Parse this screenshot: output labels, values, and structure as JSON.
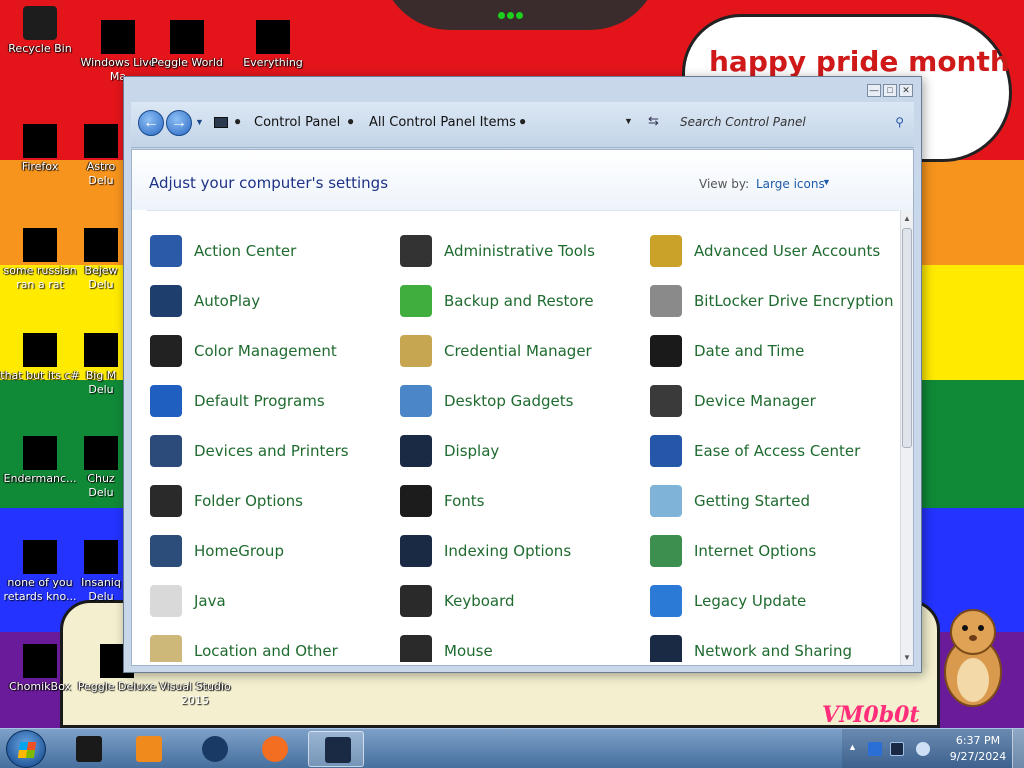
{
  "wallpaper": {
    "speech_text": "happy pride month",
    "watermark": "VM0b0t",
    "colors": {
      "red": "#e3151b",
      "orange": "#f7941d",
      "yellow": "#ffea00",
      "green": "#108a37",
      "blue": "#2433ff",
      "purple": "#6a1b9a"
    }
  },
  "desktop": {
    "icons": [
      {
        "label": "Recycle Bin",
        "icon": "recycle-bin-icon"
      },
      {
        "label": "Windows Live",
        "label2": "Ma",
        "icon": "windows-live-icon"
      },
      {
        "label": "Peggle World",
        "icon": "peggle-world-icon"
      },
      {
        "label": "Everything",
        "icon": "everything-icon"
      },
      {
        "label": "Firefox",
        "icon": "firefox-icon"
      },
      {
        "label": "Astro",
        "label2": "Delu",
        "icon": "astro-icon"
      },
      {
        "label": "some russian",
        "label2": "ran a rat",
        "icon": "file-icon"
      },
      {
        "label": "Bejew",
        "label2": "Delu",
        "icon": "bejeweled-icon"
      },
      {
        "label": "that but its c#",
        "icon": "shortcut-icon"
      },
      {
        "label": "Big M",
        "label2": "Delu",
        "icon": "big-money-icon"
      },
      {
        "label": "Endermanc...",
        "icon": "endermanch-icon"
      },
      {
        "label": "Chuz",
        "label2": "Delu",
        "icon": "chuzzle-icon"
      },
      {
        "label": "none of you",
        "label2": "retards kno...",
        "icon": "chrome-icon"
      },
      {
        "label": "Insaniq",
        "label2": "Delu",
        "icon": "insaniquarium-icon"
      },
      {
        "label": "ChomikBox",
        "icon": "chomikbox-icon"
      },
      {
        "label": "Peggle Deluxe",
        "icon": "peggle-deluxe-icon"
      },
      {
        "label": "Visual Studio",
        "label2": "2015",
        "icon": "visual-studio-icon"
      }
    ]
  },
  "window": {
    "breadcrumb": [
      "Control Panel",
      "All Control Panel Items"
    ],
    "search_placeholder": "Search Control Panel",
    "title": "Adjust your computer's settings",
    "view_by_label": "View by:",
    "view_by_value": "Large icons",
    "items": [
      {
        "name": "Action Center",
        "icon": "action-center-icon",
        "color": "#2a5aa8"
      },
      {
        "name": "Administrative Tools",
        "icon": "administrative-tools-icon",
        "color": "#333333"
      },
      {
        "name": "Advanced User Accounts",
        "icon": "user-accounts-icon",
        "color": "#c9a227"
      },
      {
        "name": "AutoPlay",
        "icon": "autoplay-icon",
        "color": "#1e3f6e"
      },
      {
        "name": "Backup and Restore",
        "icon": "backup-restore-icon",
        "color": "#3fae3f"
      },
      {
        "name": "BitLocker Drive Encryption",
        "icon": "bitlocker-icon",
        "color": "#8a8a8a"
      },
      {
        "name": "Color Management",
        "icon": "color-management-icon",
        "color": "#222222"
      },
      {
        "name": "Credential Manager",
        "icon": "credential-manager-icon",
        "color": "#c6a650"
      },
      {
        "name": "Date and Time",
        "icon": "date-time-icon",
        "color": "#1a1a1a"
      },
      {
        "name": "Default Programs",
        "icon": "default-programs-icon",
        "color": "#1f5fbf"
      },
      {
        "name": "Desktop Gadgets",
        "icon": "desktop-gadgets-icon",
        "color": "#4a86c8"
      },
      {
        "name": "Device Manager",
        "icon": "device-manager-icon",
        "color": "#3a3a3a"
      },
      {
        "name": "Devices and Printers",
        "icon": "devices-printers-icon",
        "color": "#2c4a7a"
      },
      {
        "name": "Display",
        "icon": "display-icon",
        "color": "#1b2a44"
      },
      {
        "name": "Ease of Access Center",
        "icon": "ease-of-access-icon",
        "color": "#2457a8"
      },
      {
        "name": "Folder Options",
        "icon": "folder-options-icon",
        "color": "#2a2a2a"
      },
      {
        "name": "Fonts",
        "icon": "fonts-icon",
        "color": "#1c1c1c"
      },
      {
        "name": "Getting Started",
        "icon": "getting-started-icon",
        "color": "#7fb4d8"
      },
      {
        "name": "HomeGroup",
        "icon": "homegroup-icon",
        "color": "#2c4d7a"
      },
      {
        "name": "Indexing Options",
        "icon": "indexing-options-icon",
        "color": "#1b2a44"
      },
      {
        "name": "Internet Options",
        "icon": "internet-options-icon",
        "color": "#3c8f4f"
      },
      {
        "name": "Java",
        "icon": "java-icon",
        "color": "#d9d9d9"
      },
      {
        "name": "Keyboard",
        "icon": "keyboard-icon",
        "color": "#2a2a2a"
      },
      {
        "name": "Legacy Update",
        "icon": "legacy-update-icon",
        "color": "#2b7bd6"
      },
      {
        "name": "Location and Other",
        "icon": "location-icon",
        "color": "#cdb87a"
      },
      {
        "name": "Mouse",
        "icon": "mouse-icon",
        "color": "#2a2a2a"
      },
      {
        "name": "Network and Sharing",
        "icon": "network-sharing-icon",
        "color": "#1b2a44"
      }
    ]
  },
  "taskbar": {
    "apps": [
      {
        "icon": "black-box-app-icon",
        "color": "#1a1a1a"
      },
      {
        "icon": "media-player-icon",
        "color": "#f08a1d"
      },
      {
        "icon": "globe-app-icon",
        "color": "#1a3a66"
      },
      {
        "icon": "firefox-taskbar-icon",
        "color": "#f36e20"
      },
      {
        "icon": "control-panel-taskbar-icon",
        "color": "#1b2a44"
      }
    ],
    "clock_time": "6:37 PM",
    "clock_date": "9/27/2024"
  }
}
